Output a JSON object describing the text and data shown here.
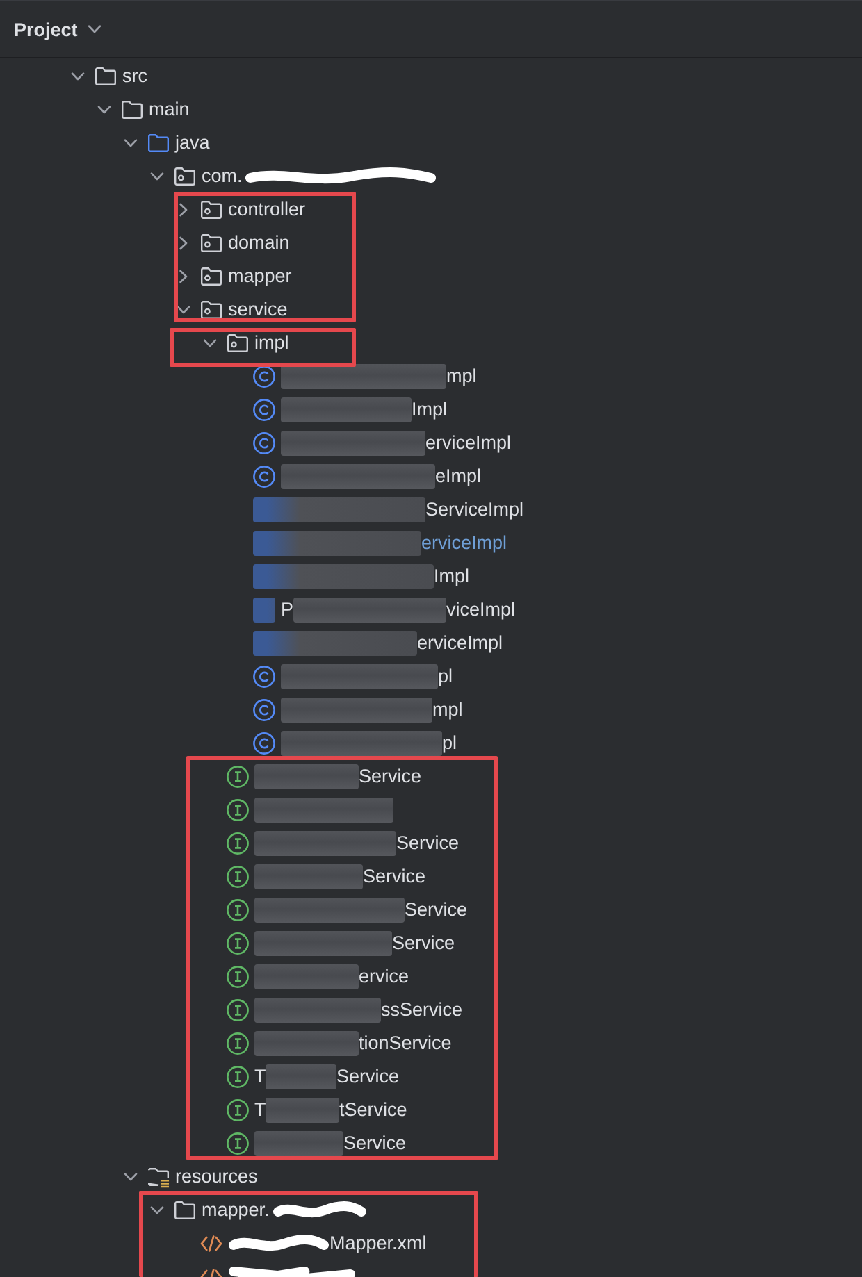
{
  "header": {
    "title": "Project"
  },
  "tree": [
    {
      "kind": "folder",
      "label": "src",
      "expanded": true,
      "children": [
        {
          "kind": "folder",
          "label": "main",
          "expanded": true,
          "children": [
            {
              "kind": "source_root",
              "label": "java",
              "expanded": true,
              "children": [
                {
                  "kind": "package",
                  "prefix": "com.",
                  "redaction": {
                    "kind": "scribble"
                  },
                  "expanded": true,
                  "children": [
                    {
                      "kind": "package",
                      "label": "controller",
                      "expanded": false
                    },
                    {
                      "kind": "package",
                      "label": "domain",
                      "expanded": false
                    },
                    {
                      "kind": "package",
                      "label": "mapper",
                      "expanded": false
                    },
                    {
                      "kind": "package",
                      "label": "service",
                      "expanded": true,
                      "children": [
                        {
                          "kind": "package",
                          "label": "impl",
                          "expanded": true,
                          "children": [
                            {
                              "kind": "class",
                              "redaction": {
                                "kind": "blur",
                                "covers_icon": false
                              },
                              "label": "mpl",
                              "modified": false
                            },
                            {
                              "kind": "class",
                              "redaction": {
                                "kind": "blur",
                                "covers_icon": false
                              },
                              "label": "Impl",
                              "modified": false
                            },
                            {
                              "kind": "class",
                              "redaction": {
                                "kind": "blur",
                                "covers_icon": false
                              },
                              "label": "erviceImpl",
                              "modified": false
                            },
                            {
                              "kind": "class",
                              "redaction": {
                                "kind": "blur",
                                "covers_icon": false
                              },
                              "label": "eImpl",
                              "modified": false
                            },
                            {
                              "kind": "class",
                              "redaction": {
                                "kind": "blur",
                                "covers_icon": true
                              },
                              "label": "ServiceImpl",
                              "modified": false
                            },
                            {
                              "kind": "class",
                              "redaction": {
                                "kind": "blur",
                                "covers_icon": true
                              },
                              "label": "erviceImpl",
                              "modified": true
                            },
                            {
                              "kind": "class",
                              "redaction": {
                                "kind": "blur",
                                "covers_icon": true
                              },
                              "label": "Impl",
                              "modified": false
                            },
                            {
                              "kind": "class",
                              "prefix": "P",
                              "redaction": {
                                "kind": "blur",
                                "covers_icon": true
                              },
                              "label": "viceImpl",
                              "modified": false
                            },
                            {
                              "kind": "class",
                              "redaction": {
                                "kind": "blur",
                                "covers_icon": true
                              },
                              "label": "erviceImpl",
                              "modified": false
                            },
                            {
                              "kind": "class",
                              "redaction": {
                                "kind": "blur",
                                "covers_icon": false
                              },
                              "label": "pl",
                              "modified": false
                            },
                            {
                              "kind": "class",
                              "redaction": {
                                "kind": "blur",
                                "covers_icon": false
                              },
                              "label": "mpl",
                              "modified": false
                            },
                            {
                              "kind": "class",
                              "redaction": {
                                "kind": "blur",
                                "covers_icon": false
                              },
                              "label": "pl",
                              "modified": false
                            }
                          ]
                        },
                        {
                          "kind": "interface",
                          "redaction": {
                            "kind": "blur",
                            "covers_icon": false
                          },
                          "label": "Service"
                        },
                        {
                          "kind": "interface",
                          "redaction": {
                            "kind": "blur",
                            "covers_icon": false
                          }
                        },
                        {
                          "kind": "interface",
                          "redaction": {
                            "kind": "blur",
                            "covers_icon": false
                          },
                          "label": "Service"
                        },
                        {
                          "kind": "interface",
                          "redaction": {
                            "kind": "blur",
                            "covers_icon": false
                          },
                          "label": "Service"
                        },
                        {
                          "kind": "interface",
                          "redaction": {
                            "kind": "blur",
                            "covers_icon": false
                          },
                          "label": "Service"
                        },
                        {
                          "kind": "interface",
                          "redaction": {
                            "kind": "blur",
                            "covers_icon": false
                          },
                          "label": "Service"
                        },
                        {
                          "kind": "interface",
                          "redaction": {
                            "kind": "blur",
                            "covers_icon": false
                          },
                          "label": "ervice"
                        },
                        {
                          "kind": "interface",
                          "redaction": {
                            "kind": "blur",
                            "covers_icon": false
                          },
                          "label": "ssService"
                        },
                        {
                          "kind": "interface",
                          "redaction": {
                            "kind": "blur",
                            "covers_icon": false
                          },
                          "label": "tionService"
                        },
                        {
                          "kind": "interface",
                          "prefix": "T",
                          "redaction": {
                            "kind": "blur",
                            "covers_icon": false
                          },
                          "label": "Service"
                        },
                        {
                          "kind": "interface",
                          "prefix": "T",
                          "redaction": {
                            "kind": "blur",
                            "covers_icon": false
                          },
                          "label": "tService"
                        },
                        {
                          "kind": "interface",
                          "redaction": {
                            "kind": "blur",
                            "covers_icon": false
                          },
                          "label": "Service"
                        }
                      ]
                    }
                  ]
                }
              ]
            },
            {
              "kind": "resources_root",
              "label": "resources",
              "expanded": true,
              "children": [
                {
                  "kind": "folder",
                  "prefix": "mapper.",
                  "redaction": {
                    "kind": "scribble"
                  },
                  "expanded": true,
                  "children": [
                    {
                      "kind": "xml",
                      "redaction": {
                        "kind": "scribble"
                      },
                      "label": "Mapper.xml"
                    },
                    {
                      "kind": "xml",
                      "redaction": {
                        "kind": "scribble"
                      }
                    }
                  ]
                }
              ]
            }
          ]
        }
      ]
    }
  ],
  "annotations": [
    {
      "kind": "frame"
    },
    {
      "kind": "frame"
    },
    {
      "kind": "frame"
    },
    {
      "kind": "frame"
    }
  ]
}
